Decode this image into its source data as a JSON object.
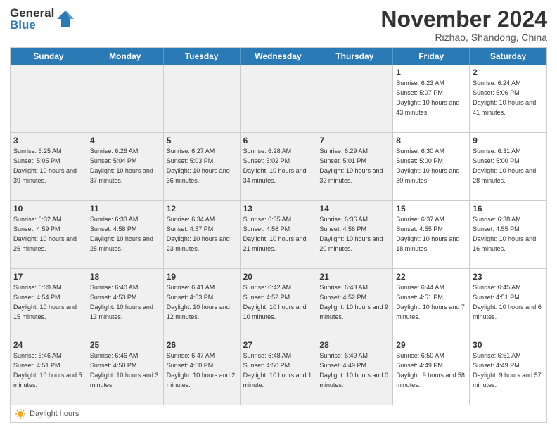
{
  "header": {
    "logo_general": "General",
    "logo_blue": "Blue",
    "month_title": "November 2024",
    "subtitle": "Rizhao, Shandong, China"
  },
  "calendar": {
    "days_of_week": [
      "Sunday",
      "Monday",
      "Tuesday",
      "Wednesday",
      "Thursday",
      "Friday",
      "Saturday"
    ],
    "rows": [
      [
        {
          "day": "",
          "info": "",
          "shaded": true
        },
        {
          "day": "",
          "info": "",
          "shaded": true
        },
        {
          "day": "",
          "info": "",
          "shaded": true
        },
        {
          "day": "",
          "info": "",
          "shaded": true
        },
        {
          "day": "",
          "info": "",
          "shaded": true
        },
        {
          "day": "1",
          "info": "Sunrise: 6:23 AM\nSunset: 5:07 PM\nDaylight: 10 hours and 43 minutes.",
          "shaded": false
        },
        {
          "day": "2",
          "info": "Sunrise: 6:24 AM\nSunset: 5:06 PM\nDaylight: 10 hours and 41 minutes.",
          "shaded": false
        }
      ],
      [
        {
          "day": "3",
          "info": "Sunrise: 6:25 AM\nSunset: 5:05 PM\nDaylight: 10 hours and 39 minutes.",
          "shaded": true
        },
        {
          "day": "4",
          "info": "Sunrise: 6:26 AM\nSunset: 5:04 PM\nDaylight: 10 hours and 37 minutes.",
          "shaded": true
        },
        {
          "day": "5",
          "info": "Sunrise: 6:27 AM\nSunset: 5:03 PM\nDaylight: 10 hours and 36 minutes.",
          "shaded": true
        },
        {
          "day": "6",
          "info": "Sunrise: 6:28 AM\nSunset: 5:02 PM\nDaylight: 10 hours and 34 minutes.",
          "shaded": true
        },
        {
          "day": "7",
          "info": "Sunrise: 6:29 AM\nSunset: 5:01 PM\nDaylight: 10 hours and 32 minutes.",
          "shaded": true
        },
        {
          "day": "8",
          "info": "Sunrise: 6:30 AM\nSunset: 5:00 PM\nDaylight: 10 hours and 30 minutes.",
          "shaded": false
        },
        {
          "day": "9",
          "info": "Sunrise: 6:31 AM\nSunset: 5:00 PM\nDaylight: 10 hours and 28 minutes.",
          "shaded": false
        }
      ],
      [
        {
          "day": "10",
          "info": "Sunrise: 6:32 AM\nSunset: 4:59 PM\nDaylight: 10 hours and 26 minutes.",
          "shaded": true
        },
        {
          "day": "11",
          "info": "Sunrise: 6:33 AM\nSunset: 4:58 PM\nDaylight: 10 hours and 25 minutes.",
          "shaded": true
        },
        {
          "day": "12",
          "info": "Sunrise: 6:34 AM\nSunset: 4:57 PM\nDaylight: 10 hours and 23 minutes.",
          "shaded": true
        },
        {
          "day": "13",
          "info": "Sunrise: 6:35 AM\nSunset: 4:56 PM\nDaylight: 10 hours and 21 minutes.",
          "shaded": true
        },
        {
          "day": "14",
          "info": "Sunrise: 6:36 AM\nSunset: 4:56 PM\nDaylight: 10 hours and 20 minutes.",
          "shaded": true
        },
        {
          "day": "15",
          "info": "Sunrise: 6:37 AM\nSunset: 4:55 PM\nDaylight: 10 hours and 18 minutes.",
          "shaded": false
        },
        {
          "day": "16",
          "info": "Sunrise: 6:38 AM\nSunset: 4:55 PM\nDaylight: 10 hours and 16 minutes.",
          "shaded": false
        }
      ],
      [
        {
          "day": "17",
          "info": "Sunrise: 6:39 AM\nSunset: 4:54 PM\nDaylight: 10 hours and 15 minutes.",
          "shaded": true
        },
        {
          "day": "18",
          "info": "Sunrise: 6:40 AM\nSunset: 4:53 PM\nDaylight: 10 hours and 13 minutes.",
          "shaded": true
        },
        {
          "day": "19",
          "info": "Sunrise: 6:41 AM\nSunset: 4:53 PM\nDaylight: 10 hours and 12 minutes.",
          "shaded": true
        },
        {
          "day": "20",
          "info": "Sunrise: 6:42 AM\nSunset: 4:52 PM\nDaylight: 10 hours and 10 minutes.",
          "shaded": true
        },
        {
          "day": "21",
          "info": "Sunrise: 6:43 AM\nSunset: 4:52 PM\nDaylight: 10 hours and 9 minutes.",
          "shaded": true
        },
        {
          "day": "22",
          "info": "Sunrise: 6:44 AM\nSunset: 4:51 PM\nDaylight: 10 hours and 7 minutes.",
          "shaded": false
        },
        {
          "day": "23",
          "info": "Sunrise: 6:45 AM\nSunset: 4:51 PM\nDaylight: 10 hours and 6 minutes.",
          "shaded": false
        }
      ],
      [
        {
          "day": "24",
          "info": "Sunrise: 6:46 AM\nSunset: 4:51 PM\nDaylight: 10 hours and 5 minutes.",
          "shaded": true
        },
        {
          "day": "25",
          "info": "Sunrise: 6:46 AM\nSunset: 4:50 PM\nDaylight: 10 hours and 3 minutes.",
          "shaded": true
        },
        {
          "day": "26",
          "info": "Sunrise: 6:47 AM\nSunset: 4:50 PM\nDaylight: 10 hours and 2 minutes.",
          "shaded": true
        },
        {
          "day": "27",
          "info": "Sunrise: 6:48 AM\nSunset: 4:50 PM\nDaylight: 10 hours and 1 minute.",
          "shaded": true
        },
        {
          "day": "28",
          "info": "Sunrise: 6:49 AM\nSunset: 4:49 PM\nDaylight: 10 hours and 0 minutes.",
          "shaded": true
        },
        {
          "day": "29",
          "info": "Sunrise: 6:50 AM\nSunset: 4:49 PM\nDaylight: 9 hours and 58 minutes.",
          "shaded": false
        },
        {
          "day": "30",
          "info": "Sunrise: 6:51 AM\nSunset: 4:49 PM\nDaylight: 9 hours and 57 minutes.",
          "shaded": false
        }
      ]
    ],
    "legend_label": "Daylight hours"
  }
}
